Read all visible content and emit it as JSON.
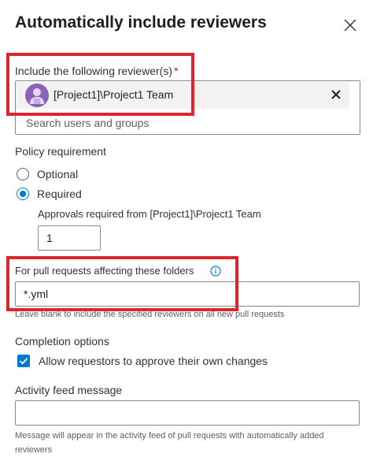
{
  "dialog": {
    "title": "Automatically include reviewers",
    "close_icon": "close-icon"
  },
  "reviewers": {
    "label": "Include the following reviewer(s)",
    "required_marker": "*",
    "selected": [
      {
        "name": "[Project1]\\Project1 Team",
        "avatar_icon": "team-avatar-icon"
      }
    ],
    "search_placeholder": "Search users and groups"
  },
  "policy": {
    "label": "Policy requirement",
    "options": [
      {
        "label": "Optional",
        "checked": false
      },
      {
        "label": "Required",
        "checked": true
      }
    ],
    "approvals_label": "Approvals required from [Project1]\\Project1 Team",
    "approvals_value": "1"
  },
  "folders": {
    "label": "For pull requests affecting these folders",
    "info_icon": "info-icon",
    "value": "*.yml",
    "helper": "Leave blank to include the specified reviewers on all new pull requests"
  },
  "completion": {
    "label": "Completion options",
    "checkbox_label": "Allow requestors to approve their own changes",
    "checked": true
  },
  "activity": {
    "label": "Activity feed message",
    "value": "",
    "helper": "Message will appear in the activity feed of pull requests with automatically added reviewers"
  },
  "colors": {
    "accent": "#0078d4",
    "highlight": "#e0242c",
    "avatar": "#8764b8",
    "required": "#a4262c"
  }
}
